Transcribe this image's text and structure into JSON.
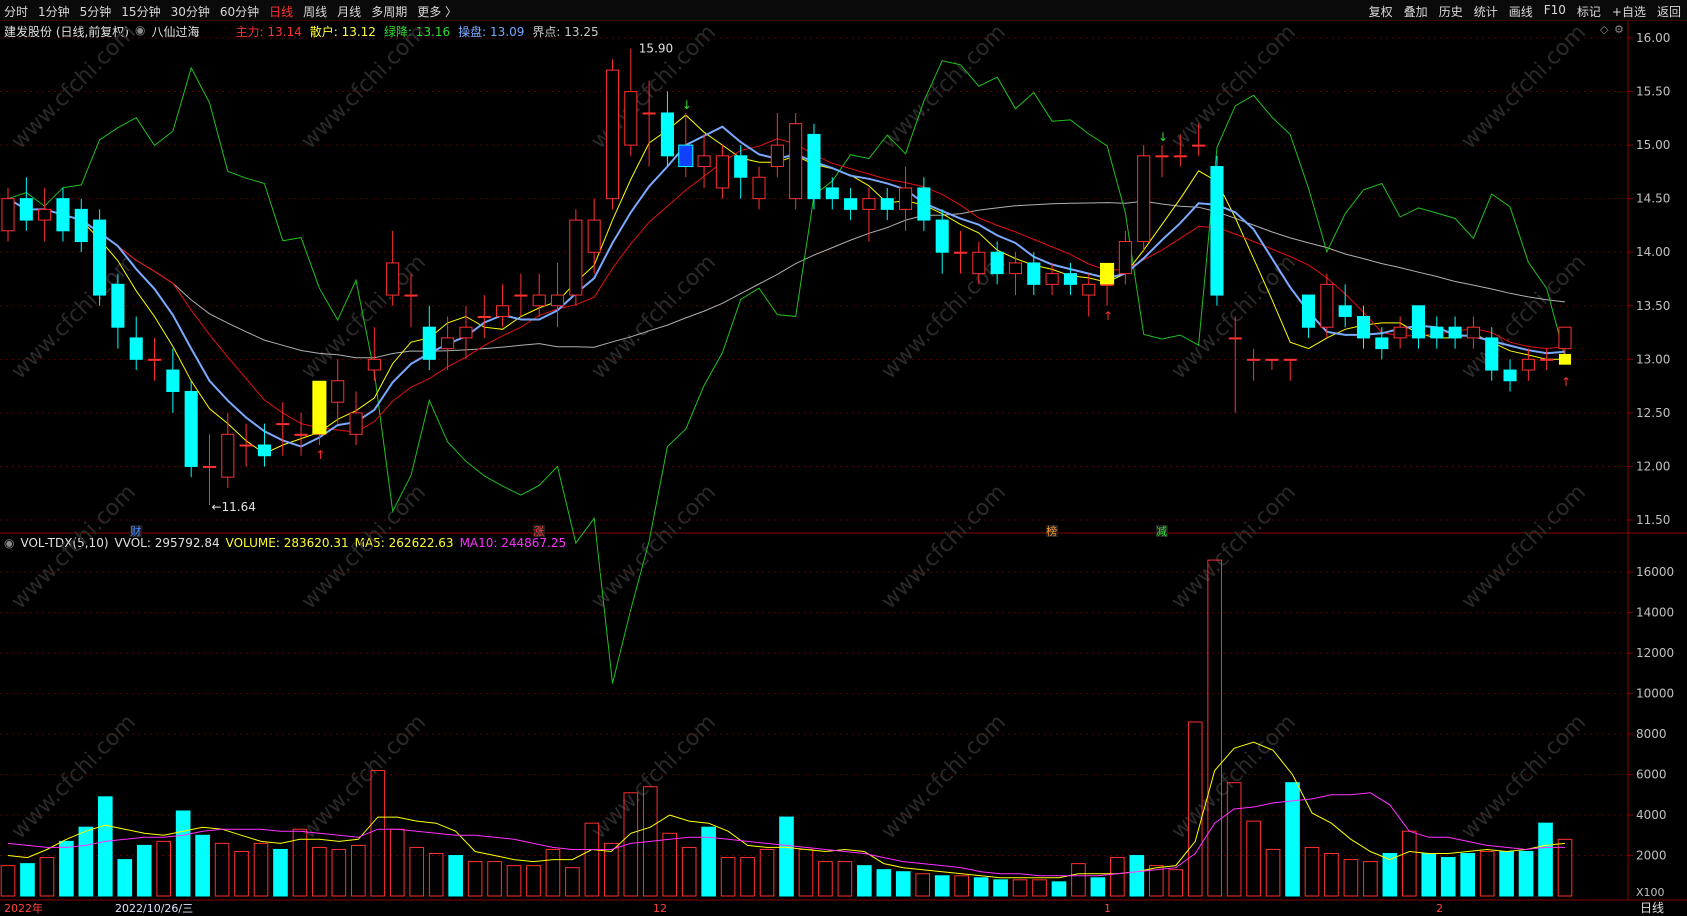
{
  "toolbar": {
    "left_items": [
      "分时",
      "1分钟",
      "5分钟",
      "15分钟",
      "30分钟",
      "60分钟",
      "日线",
      "周线",
      "月线",
      "多周期",
      "更多 〉"
    ],
    "active": "日线",
    "right_items": [
      "复权",
      "叠加",
      "历史",
      "统计",
      "画线",
      "F10",
      "标记",
      "+自选",
      "返回"
    ]
  },
  "header": {
    "stock": "建发股份 (日线,前复权)",
    "indicator": "八仙过海",
    "values": [
      {
        "label": "主力:",
        "value": "13.14",
        "color": "#ff3030"
      },
      {
        "label": "散户:",
        "value": "13.12",
        "color": "#ffff30"
      },
      {
        "label": "绿降:",
        "value": "13.16",
        "color": "#30e030"
      },
      {
        "label": "操盘:",
        "value": "13.09",
        "color": "#7aa8ff"
      },
      {
        "label": "界点:",
        "value": "13.25",
        "color": "#c8c8c8"
      }
    ]
  },
  "volume_header": {
    "indicator": "VOL-TDX(5,10)",
    "vvol": "VVOL: 295792.84",
    "volume": "VOLUME: 283620.31",
    "ma5": "MA5: 262622.63",
    "ma10": "MA10: 244867.25"
  },
  "annotations": {
    "high_label": "15.90",
    "low_label": "←11.64",
    "events": [
      "财",
      "涨",
      "榜",
      "减"
    ]
  },
  "x_axis": {
    "labels": [
      "2022年",
      "2022/10/26/三",
      "12",
      "1",
      "2"
    ],
    "period": "日线",
    "vol_unit": "X100"
  },
  "chart_data": [
    {
      "type": "candlestick",
      "title": "建发股份 (日线,前复权)",
      "ylim": [
        11.5,
        16.0
      ],
      "y_ticks": [
        "16.00",
        "15.50",
        "15.00",
        "14.50",
        "14.00",
        "13.50",
        "13.00",
        "12.50",
        "12.00",
        "11.50"
      ],
      "candles": [
        [
          14.2,
          14.5,
          14.1,
          14.6
        ],
        [
          14.5,
          14.3,
          14.2,
          14.7
        ],
        [
          14.3,
          14.4,
          14.1,
          14.6
        ],
        [
          14.5,
          14.2,
          14.1,
          14.6
        ],
        [
          14.4,
          14.1,
          14.0,
          14.5
        ],
        [
          14.3,
          13.6,
          13.5,
          14.4
        ],
        [
          13.7,
          13.3,
          13.1,
          13.8
        ],
        [
          13.2,
          13.0,
          12.9,
          13.4
        ],
        [
          13.0,
          13.0,
          12.8,
          13.2
        ],
        [
          12.9,
          12.7,
          12.5,
          13.1
        ],
        [
          12.7,
          12.0,
          11.9,
          12.8
        ],
        [
          12.0,
          12.0,
          11.64,
          12.3
        ],
        [
          11.9,
          12.3,
          11.8,
          12.5
        ],
        [
          12.2,
          12.2,
          12.0,
          12.4
        ],
        [
          12.2,
          12.1,
          12.0,
          12.4
        ],
        [
          12.4,
          12.4,
          12.1,
          12.6
        ],
        [
          12.3,
          12.3,
          12.1,
          12.5
        ],
        [
          12.3,
          12.6,
          12.2,
          12.7
        ],
        [
          12.6,
          12.8,
          12.4,
          13.0
        ],
        [
          12.3,
          12.5,
          12.2,
          12.7
        ],
        [
          12.9,
          13.0,
          12.8,
          13.3
        ],
        [
          13.6,
          13.9,
          13.5,
          14.2
        ],
        [
          13.6,
          13.6,
          13.3,
          13.8
        ],
        [
          13.3,
          13.0,
          12.9,
          13.5
        ],
        [
          13.1,
          13.2,
          12.9,
          13.4
        ],
        [
          13.2,
          13.3,
          13.0,
          13.5
        ],
        [
          13.4,
          13.4,
          13.2,
          13.6
        ],
        [
          13.4,
          13.5,
          13.3,
          13.7
        ],
        [
          13.6,
          13.6,
          13.4,
          13.8
        ],
        [
          13.5,
          13.6,
          13.4,
          13.8
        ],
        [
          13.5,
          13.6,
          13.3,
          13.9
        ],
        [
          13.6,
          14.3,
          13.5,
          14.4
        ],
        [
          14.0,
          14.3,
          13.8,
          14.5
        ],
        [
          14.5,
          15.7,
          14.4,
          15.8
        ],
        [
          15.0,
          15.5,
          14.9,
          15.9
        ],
        [
          15.3,
          15.3,
          14.8,
          15.6
        ],
        [
          15.3,
          14.9,
          14.8,
          15.5
        ],
        [
          14.8,
          15.0,
          14.7,
          15.3
        ],
        [
          14.8,
          14.9,
          14.6,
          15.1
        ],
        [
          14.6,
          14.9,
          14.5,
          15.0
        ],
        [
          14.9,
          14.7,
          14.5,
          15.0
        ],
        [
          14.5,
          14.7,
          14.4,
          14.8
        ],
        [
          14.8,
          15.0,
          14.7,
          15.3
        ],
        [
          14.5,
          15.2,
          14.4,
          15.3
        ],
        [
          15.1,
          14.5,
          14.4,
          15.2
        ],
        [
          14.6,
          14.5,
          14.4,
          14.7
        ],
        [
          14.5,
          14.4,
          14.3,
          14.6
        ],
        [
          14.4,
          14.5,
          14.1,
          14.6
        ],
        [
          14.5,
          14.4,
          14.3,
          14.6
        ],
        [
          14.4,
          14.6,
          14.2,
          14.8
        ],
        [
          14.6,
          14.3,
          14.2,
          14.7
        ],
        [
          14.3,
          14.0,
          13.8,
          14.4
        ],
        [
          14.0,
          14.0,
          13.8,
          14.2
        ],
        [
          13.8,
          14.0,
          13.7,
          14.1
        ],
        [
          14.0,
          13.8,
          13.7,
          14.1
        ],
        [
          13.8,
          13.9,
          13.6,
          14.0
        ],
        [
          13.9,
          13.7,
          13.6,
          14.0
        ],
        [
          13.7,
          13.8,
          13.6,
          13.9
        ],
        [
          13.8,
          13.7,
          13.6,
          13.9
        ],
        [
          13.6,
          13.7,
          13.4,
          13.8
        ],
        [
          13.7,
          13.7,
          13.5,
          13.8
        ],
        [
          13.8,
          14.1,
          13.7,
          14.2
        ],
        [
          14.1,
          14.9,
          14.0,
          15.0
        ],
        [
          14.9,
          14.9,
          14.7,
          15.0
        ],
        [
          14.9,
          14.9,
          14.8,
          15.1
        ],
        [
          15.0,
          15.0,
          14.9,
          15.2
        ],
        [
          14.8,
          13.6,
          13.5,
          14.9
        ],
        [
          13.2,
          13.2,
          12.5,
          13.4
        ],
        [
          13.0,
          13.0,
          12.8,
          13.1
        ],
        [
          13.0,
          13.0,
          12.9,
          13.0
        ],
        [
          13.0,
          13.0,
          12.8,
          13.0
        ],
        [
          13.6,
          13.3,
          13.2,
          13.6
        ],
        [
          13.3,
          13.7,
          13.2,
          13.8
        ],
        [
          13.5,
          13.4,
          13.3,
          13.7
        ],
        [
          13.4,
          13.2,
          13.1,
          13.5
        ],
        [
          13.2,
          13.1,
          13.0,
          13.3
        ],
        [
          13.2,
          13.3,
          13.1,
          13.4
        ],
        [
          13.5,
          13.2,
          13.1,
          13.5
        ],
        [
          13.3,
          13.2,
          13.1,
          13.4
        ],
        [
          13.3,
          13.2,
          13.1,
          13.4
        ],
        [
          13.2,
          13.3,
          13.1,
          13.4
        ],
        [
          13.2,
          12.9,
          12.8,
          13.3
        ],
        [
          12.9,
          12.8,
          12.7,
          13.0
        ],
        [
          12.9,
          13.0,
          12.8,
          13.1
        ],
        [
          13.0,
          13.0,
          12.9,
          13.1
        ],
        [
          13.1,
          13.3,
          13.0,
          13.3
        ]
      ],
      "candle_fields": [
        "open",
        "close",
        "low",
        "high"
      ],
      "signals": {
        "yellow_up": [
          17,
          60
        ],
        "blue_down": [
          37,
          63
        ],
        "yellow_small": 85
      }
    },
    {
      "type": "bar",
      "title": "VOL-TDX(5,10)",
      "ylim": [
        0,
        17000
      ],
      "y_ticks": [
        "16000",
        "14000",
        "12000",
        "10000",
        "8000",
        "6000",
        "4000",
        "2000"
      ],
      "series": [
        {
          "name": "VOLUME",
          "values": [
            1500,
            1600,
            1900,
            2700,
            3400,
            4900,
            1800,
            2500,
            2700,
            4200,
            3000,
            2600,
            2200,
            2600,
            2300,
            3300,
            2400,
            2300,
            2500,
            6200,
            3300,
            2400,
            2100,
            2000,
            1700,
            1700,
            1500,
            1500,
            2300,
            1400,
            3600,
            2600,
            5100,
            5400,
            3100,
            2400,
            3400,
            1900,
            1900,
            2300,
            3900,
            2300,
            1700,
            1700,
            1500,
            1300,
            1200,
            1100,
            1000,
            1000,
            900,
            800,
            800,
            800,
            700,
            1600,
            900,
            1900,
            2000,
            1500,
            1300,
            8600,
            16600,
            5600,
            3700,
            2300,
            5600,
            2400,
            2100,
            1800,
            1700,
            2100,
            3200,
            2100,
            1900,
            2100,
            2200,
            2200,
            2200,
            3600,
            2800
          ]
        },
        {
          "name": "MA5",
          "values": [
            2000,
            1900,
            2300,
            2800,
            3200,
            3500,
            3300,
            3100,
            3000,
            3200,
            3400,
            3300,
            3000,
            2700,
            2600,
            2800,
            2800,
            2700,
            2800,
            3900,
            3900,
            3700,
            3600,
            3200,
            2200,
            2000,
            1800,
            1700,
            1800,
            1800,
            2300,
            2200,
            3100,
            3400,
            4000,
            3700,
            3600,
            3200,
            2500,
            2400,
            2400,
            2300,
            2200,
            2300,
            2200,
            1600,
            1400,
            1300,
            1200,
            1100,
            1000,
            900,
            900,
            900,
            900,
            1100,
            1100,
            1100,
            1200,
            1400,
            1500,
            2700,
            6200,
            7300,
            7600,
            7200,
            6000,
            4100,
            3600,
            2800,
            2200,
            1800,
            2200,
            2100,
            2100,
            2200,
            2300,
            2200,
            2300,
            2500,
            2600
          ]
        },
        {
          "name": "MA10",
          "values": [
            2600,
            2500,
            2400,
            2400,
            2500,
            2700,
            2800,
            2900,
            2900,
            3000,
            3200,
            3300,
            3300,
            3300,
            3200,
            3200,
            3100,
            3000,
            2900,
            3300,
            3300,
            3200,
            3100,
            3000,
            3000,
            2900,
            2800,
            2600,
            2400,
            2300,
            2300,
            2300,
            2600,
            2700,
            2800,
            2900,
            2900,
            2800,
            2700,
            2600,
            2500,
            2400,
            2300,
            2200,
            2100,
            1900,
            1700,
            1600,
            1500,
            1400,
            1200,
            1100,
            1100,
            1000,
            1000,
            1000,
            1000,
            1100,
            1200,
            1300,
            1400,
            2100,
            3600,
            4300,
            4400,
            4600,
            4700,
            4800,
            5000,
            5000,
            5100,
            4500,
            3200,
            2900,
            2900,
            2700,
            2500,
            2400,
            2300,
            2400,
            2400
          ]
        }
      ]
    }
  ],
  "colors": {
    "up": "#ff3030",
    "down": "#00ffff",
    "ma_red": "#e01010",
    "ma_yellow": "#ffff00",
    "ma_green": "#20c020",
    "ma_blue": "#7aaaff",
    "ma_white": "#b0b0b0",
    "vol_ma10": "#ff30ff"
  }
}
